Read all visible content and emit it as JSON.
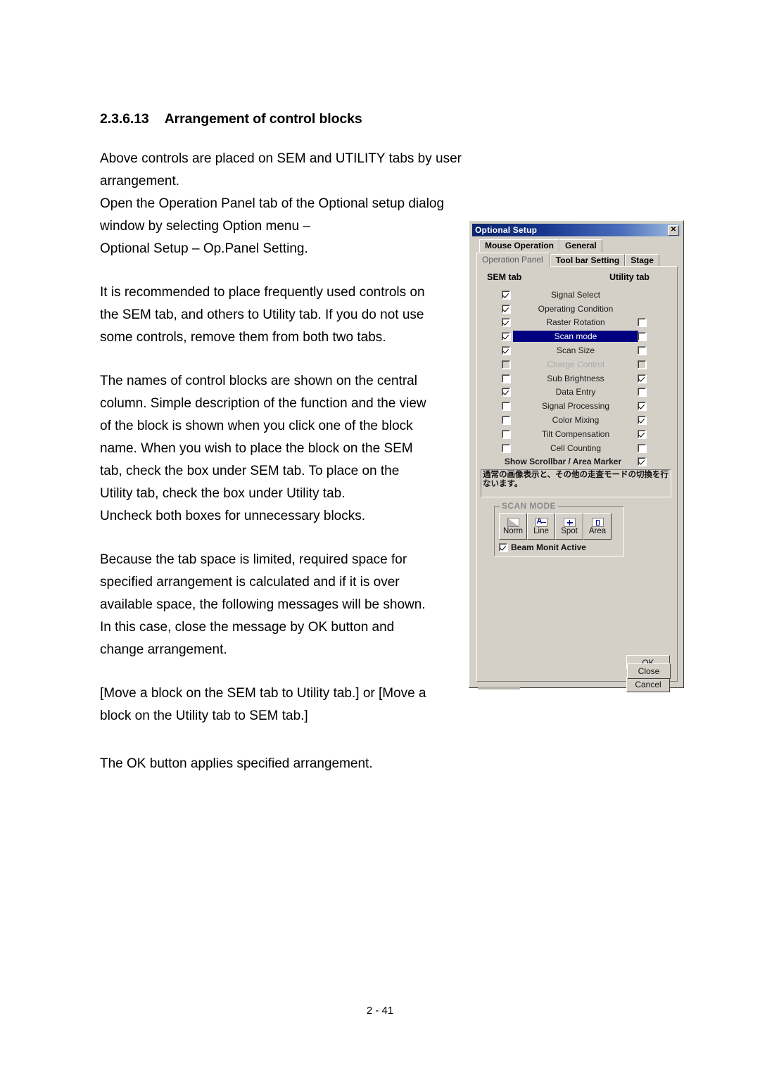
{
  "document": {
    "heading_number": "2.3.6.13",
    "heading_title": "Arrangement of control blocks",
    "paragraphs": [
      [
        "Above controls are placed on SEM and UTILITY tabs by user arrangement.",
        "Open the Operation Panel tab of the Optional setup dialog window by selecting Option menu –",
        "Optional Setup – Op.Panel Setting."
      ],
      [
        "It is recommended to place frequently used controls on",
        "the SEM tab, and others to Utility tab. If you do not use",
        "some controls, remove them from both two tabs."
      ],
      [
        "The names of control blocks are shown on the central",
        "column. Simple description of the function and the view",
        "of the block is shown when you click one of the block",
        "name. When you wish to place the block on the SEM",
        "tab, check the box under SEM tab. To place on the",
        "Utility tab, check the box under Utility tab.",
        "Uncheck both boxes for unnecessary blocks."
      ],
      [
        "Because the tab space is limited, required space for",
        "specified arrangement is calculated and if it is over",
        "available space, the following messages will be shown.",
        "In this case, close the message by OK button and",
        "change arrangement."
      ],
      [
        "[Move a block on the SEM tab to Utility tab.] or [Move a",
        "block on the Utility tab to SEM tab.]"
      ],
      [
        "The OK button applies specified arrangement."
      ]
    ],
    "page_number": "2 - 41"
  },
  "dialog": {
    "title": "Optional Setup",
    "close_icon_label": "✕",
    "tabs_row1": [
      {
        "label": "Mouse Operation",
        "active": false
      },
      {
        "label": "General",
        "active": false
      }
    ],
    "tabs_row2": [
      {
        "label": "Operation Panel",
        "active": true
      },
      {
        "label": "Tool bar Setting",
        "active": false
      },
      {
        "label": "Stage",
        "active": false
      }
    ],
    "column_headers": {
      "sem": "SEM tab",
      "utility": "Utility tab"
    },
    "rows": [
      {
        "label": "Signal Select",
        "sem": "checked",
        "utility": "none",
        "selected": false,
        "disabled": false
      },
      {
        "label": "Operating Condition",
        "sem": "checked",
        "utility": "none",
        "selected": false,
        "disabled": false
      },
      {
        "label": "Raster Rotation",
        "sem": "checked",
        "utility": "unchecked",
        "selected": false,
        "disabled": false
      },
      {
        "label": "Scan mode",
        "sem": "checked",
        "utility": "unchecked",
        "selected": true,
        "disabled": false
      },
      {
        "label": "Scan Size",
        "sem": "checked",
        "utility": "unchecked",
        "selected": false,
        "disabled": false
      },
      {
        "label": "Charge Control",
        "sem": "disabled",
        "utility": "disabled",
        "selected": false,
        "disabled": true
      },
      {
        "label": "Sub Brightness",
        "sem": "unchecked",
        "utility": "checked",
        "selected": false,
        "disabled": false
      },
      {
        "label": "Data Entry",
        "sem": "checked",
        "utility": "unchecked",
        "selected": false,
        "disabled": false
      },
      {
        "label": "Signal Processing",
        "sem": "unchecked",
        "utility": "checked",
        "selected": false,
        "disabled": false
      },
      {
        "label": "Color Mixing",
        "sem": "unchecked",
        "utility": "checked",
        "selected": false,
        "disabled": false
      },
      {
        "label": "Tilt Compensation",
        "sem": "unchecked",
        "utility": "checked",
        "selected": false,
        "disabled": false
      },
      {
        "label": "Cell Counting",
        "sem": "unchecked",
        "utility": "unchecked",
        "selected": false,
        "disabled": false
      }
    ],
    "scrollbar_row": {
      "label": "Show Scrollbar / Area Marker",
      "utility": "checked"
    },
    "description": "通常の画像表示と、その他の走査モードの切換を行ないます。",
    "scan_mode": {
      "group_title": "SCAN MODE",
      "buttons": [
        {
          "label": "Norm",
          "icon": "normal-scan-icon"
        },
        {
          "label": "Line",
          "icon": "line-scan-icon"
        },
        {
          "label": "Spot",
          "icon": "spot-scan-icon"
        },
        {
          "label": "Area",
          "icon": "area-scan-icon"
        }
      ],
      "beam_monitor": {
        "label": "Beam Monit Active",
        "state": "checked"
      }
    },
    "buttons": {
      "ok": "OK",
      "cancel": "Cancel",
      "close": "Close"
    },
    "colors": {
      "titlebar_start": "#0a246a",
      "titlebar_end": "#a6bfe0",
      "face": "#d4d0c8",
      "selection": "#000080",
      "disabled_text": "#a9a9a9"
    }
  }
}
